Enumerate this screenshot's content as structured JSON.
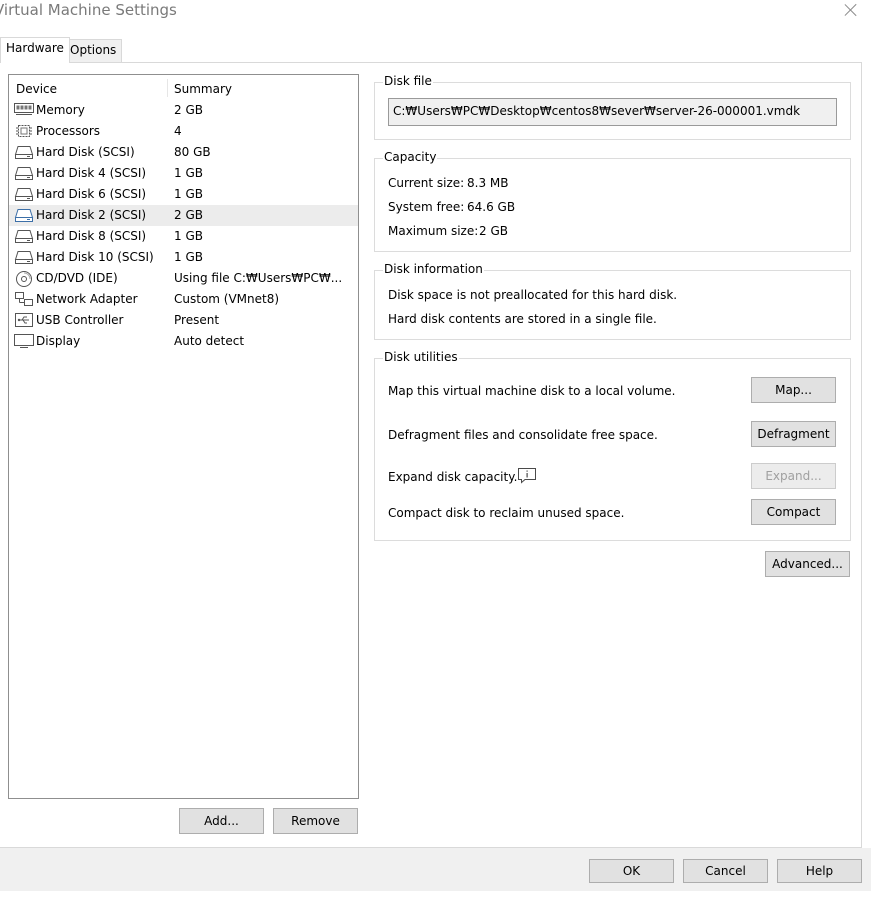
{
  "window": {
    "title": "Virtual Machine Settings"
  },
  "tabs": [
    {
      "label": "Hardware"
    },
    {
      "label": "Options"
    }
  ],
  "device_list": {
    "headers": {
      "device": "Device",
      "summary": "Summary"
    },
    "rows": [
      {
        "icon": "memory-icon",
        "device": "Memory",
        "summary": "2 GB"
      },
      {
        "icon": "processor-icon",
        "device": "Processors",
        "summary": "4"
      },
      {
        "icon": "hard-disk-icon",
        "device": "Hard Disk (SCSI)",
        "summary": "80 GB"
      },
      {
        "icon": "hard-disk-icon",
        "device": "Hard Disk 4 (SCSI)",
        "summary": "1 GB"
      },
      {
        "icon": "hard-disk-icon",
        "device": "Hard Disk 6 (SCSI)",
        "summary": "1 GB"
      },
      {
        "icon": "hard-disk-icon",
        "device": "Hard Disk 2 (SCSI)",
        "summary": "2 GB",
        "selected": true
      },
      {
        "icon": "hard-disk-icon",
        "device": "Hard Disk 8 (SCSI)",
        "summary": "1 GB"
      },
      {
        "icon": "hard-disk-icon",
        "device": "Hard Disk 10 (SCSI)",
        "summary": "1 GB"
      },
      {
        "icon": "cd-dvd-icon",
        "device": "CD/DVD (IDE)",
        "summary": "Using file C:₩Users₩PC₩..."
      },
      {
        "icon": "network-adapter-icon",
        "device": "Network Adapter",
        "summary": "Custom (VMnet8)"
      },
      {
        "icon": "usb-icon",
        "device": "USB Controller",
        "summary": "Present"
      },
      {
        "icon": "display-icon",
        "device": "Display",
        "summary": "Auto detect"
      }
    ]
  },
  "list_buttons": {
    "add": "Add...",
    "remove": "Remove"
  },
  "disk_file": {
    "title": "Disk file",
    "path": "C:₩Users₩PC₩Desktop₩centos8₩sever₩server-26-000001.vmdk"
  },
  "capacity": {
    "title": "Capacity",
    "current_label": "Current size:",
    "current_value": "8.3 MB",
    "free_label": "System free:",
    "free_value": "64.6 GB",
    "max_label": "Maximum size:",
    "max_value": "2 GB"
  },
  "disk_info": {
    "title": "Disk information",
    "line1": "Disk space is not preallocated for this hard disk.",
    "line2": "Hard disk contents are stored in a single file."
  },
  "disk_utilities": {
    "title": "Disk utilities",
    "map_text": "Map this virtual machine disk to a local volume.",
    "map_button": "Map...",
    "defrag_text": "Defragment files and consolidate free space.",
    "defrag_button": "Defragment",
    "expand_text": "Expand disk capacity.",
    "expand_button": "Expand...",
    "compact_text": "Compact disk to reclaim unused space.",
    "compact_button": "Compact"
  },
  "advanced_button": "Advanced...",
  "footer": {
    "ok": "OK",
    "cancel": "Cancel",
    "help": "Help"
  }
}
